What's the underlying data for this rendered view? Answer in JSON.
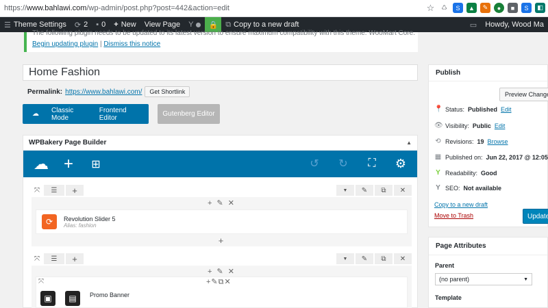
{
  "browser": {
    "url_scheme": "https://",
    "url_host": "www.bahlawi.com",
    "url_path": "/wp-admin/post.php?post=442&action=edit"
  },
  "adminbar": {
    "theme_settings": "Theme Settings",
    "updates_count": "2",
    "comments_count": "0",
    "new_label": "New",
    "view_page": "View Page",
    "copy_draft": "Copy to a new draft",
    "howdy": "Howdy, Wood Ma"
  },
  "notice": {
    "text": "The following plugin needs to be updated to its latest version to ensure maximum compatibility with this theme: WooMart Core.",
    "begin_link": "Begin updating plugin",
    "separator": "|",
    "dismiss_link": "Dismiss this notice"
  },
  "post": {
    "title": "Home Fashion",
    "permalink_label": "Permalink:",
    "permalink_url": "https://www.bahlawi.com/",
    "shortlink_button": "Get Shortlink"
  },
  "editor_modes": {
    "classic": "Classic Mode",
    "frontend": "Frontend Editor",
    "gutenberg": "Gutenberg Editor"
  },
  "wpbakery": {
    "title": "WPBakery Page Builder",
    "row1": {
      "element_name": "Revolution Slider 5",
      "element_sub": "Alias: fashion"
    },
    "row2": {
      "element_name": "Promo Banner"
    }
  },
  "publish": {
    "title": "Publish",
    "preview_button": "Preview Changes",
    "status_label": "Status:",
    "status_value": "Published",
    "visibility_label": "Visibility:",
    "visibility_value": "Public",
    "revisions_label": "Revisions:",
    "revisions_value": "19",
    "browse": "Browse",
    "published_on_label": "Published on:",
    "published_on_value": "Jun 22, 2017 @ 12:05",
    "readability_label": "Readability:",
    "readability_value": "Good",
    "seo_label": "SEO:",
    "seo_value": "Not available",
    "edit_link": "Edit",
    "copy_draft_link": "Copy to a new draft",
    "trash_link": "Move to Trash",
    "update_button": "Update"
  },
  "page_attributes": {
    "title": "Page Attributes",
    "parent_label": "Parent",
    "parent_value": "(no parent)",
    "template_label": "Template"
  },
  "colors": {
    "wp_blue": "#0073aa",
    "admin_bar": "#23282d",
    "notice_green": "#46b450",
    "trash_red": "#a00"
  }
}
